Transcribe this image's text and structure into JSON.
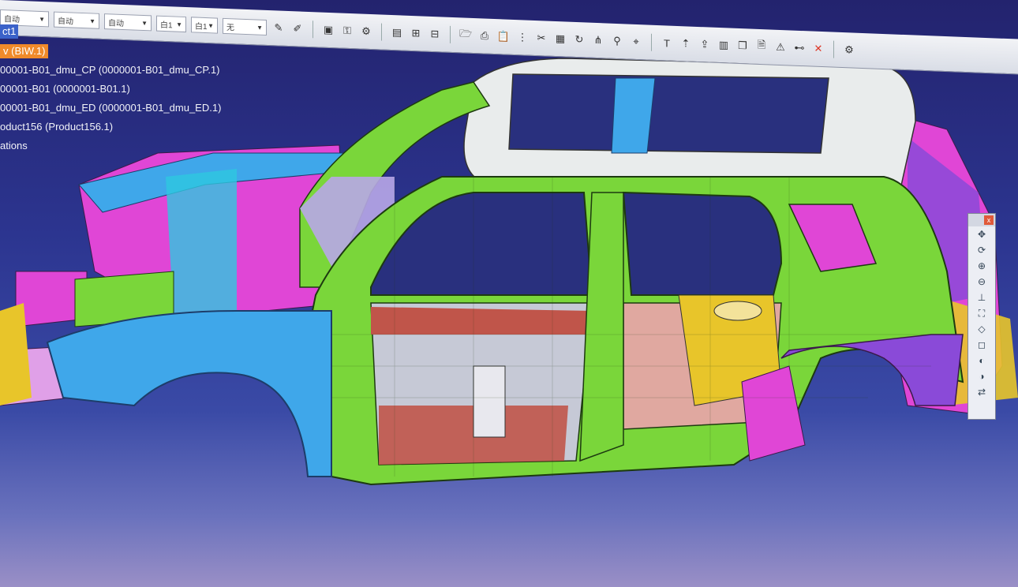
{
  "toolbar": {
    "combos": [
      "自动",
      "自动",
      "自动",
      "白1",
      "白1",
      "无"
    ],
    "colors": {
      "bg": "#e3e6ee",
      "accent": "#3b62c9"
    }
  },
  "tree": {
    "root_label": "ct1",
    "nodes": [
      {
        "label": "v (BIW.1)",
        "selected": true
      },
      {
        "label": "00001-B01_dmu_CP (0000001-B01_dmu_CP.1)"
      },
      {
        "label": "00001-B01 (0000001-B01.1)"
      },
      {
        "label": "00001-B01_dmu_ED (0000001-B01_dmu_ED.1)"
      },
      {
        "label": "oduct156 (Product156.1)"
      },
      {
        "label": "ations"
      }
    ]
  },
  "compass_toolbar": {
    "close_label": "x",
    "buttons": [
      "pan-icon",
      "rotate-icon",
      "zoom-in-icon",
      "zoom-out-icon",
      "normal-view-icon",
      "fit-all-icon",
      "iso-view-icon",
      "front-view-icon",
      "shading-icon",
      "hide-show-icon",
      "swap-icon"
    ]
  },
  "viewport": {
    "model": "vehicle body-in-white side view",
    "part_colors": {
      "body_side": "#7ad63a",
      "roof": "#e9ecec",
      "fender": "#3fa7ea",
      "inner_panels": "#e046d6",
      "floor": "#c0554a",
      "rear_floor": "#e8c52a",
      "cyan_parts": "#2ec8e0",
      "purple_parts": "#8a4ad8",
      "lavender_parts": "#b8a7e8"
    }
  }
}
